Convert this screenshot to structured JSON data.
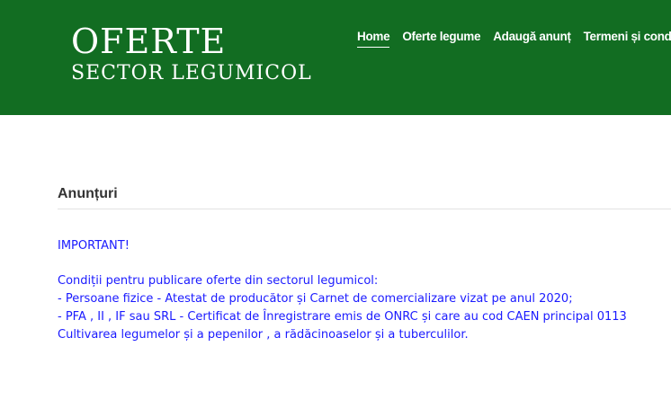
{
  "header": {
    "logo_title": "OFERTE",
    "logo_subtitle": "SECTOR LEGUMICOL",
    "background_color": "#126d22"
  },
  "nav": {
    "items": [
      {
        "label": "Home",
        "active": true
      },
      {
        "label": "Oferte legume",
        "active": false
      },
      {
        "label": "Adaugă anunț",
        "active": false
      },
      {
        "label": "Termeni și condiții",
        "active": false
      }
    ]
  },
  "main": {
    "section_title": "Anunțuri",
    "important_label": "IMPORTANT!",
    "conditions_heading": "Condiții pentru publicare oferte din sectorul legumicol:",
    "conditions": [
      "- Persoane fizice - Atestat de producător și Carnet de comercializare vizat pe anul 2020;",
      "- PFA , II , IF sau SRL - Certificat de Înregistrare emis de ONRC și care au cod CAEN principal 0113 Cultivarea legumelor și a pepenilor , a rădăcinoaselor și a tuberculilor."
    ],
    "text_color": "#1a1aff"
  }
}
